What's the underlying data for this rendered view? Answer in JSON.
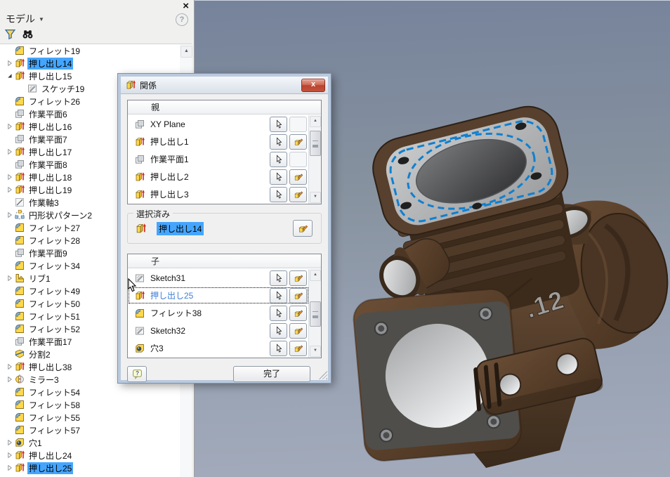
{
  "panel": {
    "title": "モデル",
    "close_glyph": "×",
    "help_glyph": "?",
    "tree": [
      {
        "label": "フィレット19",
        "icon": "fillet",
        "arrow": "none",
        "depth": 1,
        "selected": false
      },
      {
        "label": "押し出し14",
        "icon": "extrude",
        "arrow": "collapsed",
        "depth": 1,
        "selected": true
      },
      {
        "label": "押し出し15",
        "icon": "extrude",
        "arrow": "expanded",
        "depth": 1,
        "selected": false
      },
      {
        "label": "スケッチ19",
        "icon": "sketch",
        "arrow": "none",
        "depth": 2,
        "selected": false
      },
      {
        "label": "フィレット26",
        "icon": "fillet",
        "arrow": "none",
        "depth": 1,
        "selected": false
      },
      {
        "label": "作業平面6",
        "icon": "workplane",
        "arrow": "none",
        "depth": 1,
        "selected": false
      },
      {
        "label": "押し出し16",
        "icon": "extrude",
        "arrow": "collapsed",
        "depth": 1,
        "selected": false
      },
      {
        "label": "作業平面7",
        "icon": "workplane",
        "arrow": "none",
        "depth": 1,
        "selected": false
      },
      {
        "label": "押し出し17",
        "icon": "extrude",
        "arrow": "collapsed",
        "depth": 1,
        "selected": false
      },
      {
        "label": "作業平面8",
        "icon": "workplane",
        "arrow": "none",
        "depth": 1,
        "selected": false
      },
      {
        "label": "押し出し18",
        "icon": "extrude",
        "arrow": "collapsed",
        "depth": 1,
        "selected": false
      },
      {
        "label": "押し出し19",
        "icon": "extrude",
        "arrow": "collapsed",
        "depth": 1,
        "selected": false
      },
      {
        "label": "作業軸3",
        "icon": "workaxis",
        "arrow": "none",
        "depth": 1,
        "selected": false
      },
      {
        "label": "円形状パターン2",
        "icon": "circpattern",
        "arrow": "collapsed",
        "depth": 1,
        "selected": false
      },
      {
        "label": "フィレット27",
        "icon": "fillet",
        "arrow": "none",
        "depth": 1,
        "selected": false
      },
      {
        "label": "フィレット28",
        "icon": "fillet",
        "arrow": "none",
        "depth": 1,
        "selected": false
      },
      {
        "label": "作業平面9",
        "icon": "workplane",
        "arrow": "none",
        "depth": 1,
        "selected": false
      },
      {
        "label": "フィレット34",
        "icon": "fillet",
        "arrow": "none",
        "depth": 1,
        "selected": false
      },
      {
        "label": "リブ1",
        "icon": "rib",
        "arrow": "collapsed",
        "depth": 1,
        "selected": false
      },
      {
        "label": "フィレット49",
        "icon": "fillet",
        "arrow": "none",
        "depth": 1,
        "selected": false
      },
      {
        "label": "フィレット50",
        "icon": "fillet",
        "arrow": "none",
        "depth": 1,
        "selected": false
      },
      {
        "label": "フィレット51",
        "icon": "fillet",
        "arrow": "none",
        "depth": 1,
        "selected": false
      },
      {
        "label": "フィレット52",
        "icon": "fillet",
        "arrow": "none",
        "depth": 1,
        "selected": false
      },
      {
        "label": "作業平面17",
        "icon": "workplane",
        "arrow": "none",
        "depth": 1,
        "selected": false
      },
      {
        "label": "分割2",
        "icon": "split",
        "arrow": "none",
        "depth": 1,
        "selected": false
      },
      {
        "label": "押し出し38",
        "icon": "extrude",
        "arrow": "collapsed",
        "depth": 1,
        "selected": false
      },
      {
        "label": "ミラー3",
        "icon": "mirror",
        "arrow": "collapsed",
        "depth": 1,
        "selected": false
      },
      {
        "label": "フィレット54",
        "icon": "fillet",
        "arrow": "none",
        "depth": 1,
        "selected": false
      },
      {
        "label": "フィレット58",
        "icon": "fillet",
        "arrow": "none",
        "depth": 1,
        "selected": false
      },
      {
        "label": "フィレット55",
        "icon": "fillet",
        "arrow": "none",
        "depth": 1,
        "selected": false
      },
      {
        "label": "フィレット57",
        "icon": "fillet",
        "arrow": "none",
        "depth": 1,
        "selected": false
      },
      {
        "label": "穴1",
        "icon": "hole",
        "arrow": "collapsed",
        "depth": 1,
        "selected": false
      },
      {
        "label": "押し出し24",
        "icon": "extrude",
        "arrow": "collapsed",
        "depth": 1,
        "selected": false
      },
      {
        "label": "押し出し25",
        "icon": "extrude",
        "arrow": "collapsed",
        "depth": 1,
        "selected": true
      }
    ]
  },
  "dialog": {
    "title": "関係",
    "close_glyph": "x",
    "parent": {
      "header": "親",
      "rows": [
        {
          "label": "XY Plane",
          "icon": "workplane",
          "edit": false
        },
        {
          "label": "押し出し1",
          "icon": "extrude",
          "edit": true
        },
        {
          "label": "作業平面1",
          "icon": "workplane",
          "edit": false
        },
        {
          "label": "押し出し2",
          "icon": "extrude",
          "edit": true
        },
        {
          "label": "押し出し3",
          "icon": "extrude",
          "edit": true
        }
      ]
    },
    "selected": {
      "label": "選択済み",
      "item": "押し出し14",
      "icon": "extrude"
    },
    "children": {
      "header": "子",
      "rows": [
        {
          "label": "Sketch31",
          "icon": "sketch",
          "edit": true,
          "focused": false
        },
        {
          "label": "押し出し25",
          "icon": "extrude",
          "edit": true,
          "focused": true
        },
        {
          "label": "フィレット38",
          "icon": "fillet",
          "edit": true,
          "focused": false
        },
        {
          "label": "Sketch32",
          "icon": "sketch",
          "edit": true,
          "focused": false
        },
        {
          "label": "穴3",
          "icon": "hole",
          "edit": true,
          "focused": false
        }
      ]
    },
    "help_label": "?",
    "done_label": "完了"
  },
  "viewport": {
    "model_badge": ".12"
  },
  "colors": {
    "selection_blue": "#45a5fd",
    "highlight_edge_blue": "#1080cf",
    "body_brown": "#5a4129",
    "viewport_top": "#76839b",
    "viewport_bottom": "#a3abbb"
  }
}
